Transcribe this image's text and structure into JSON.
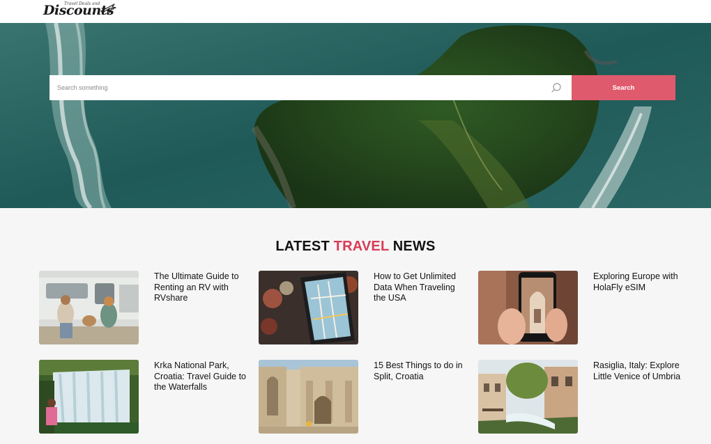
{
  "header": {
    "logo_text": "Discounts",
    "logo_small_text": "Travel Deals and"
  },
  "search": {
    "placeholder": "Search something",
    "button_label": "Search"
  },
  "news": {
    "title_prefix": "LATEST",
    "title_accent": "TRAVEL",
    "title_suffix": "NEWS",
    "accent_color": "#d93b55",
    "articles": [
      {
        "title": "The Ultimate Guide to Renting an RV with RVshare"
      },
      {
        "title": "How to Get Unlimited Data When Traveling the USA"
      },
      {
        "title": "Exploring Europe with HolaFly eSIM"
      },
      {
        "title": "Krka National Park, Croatia: Travel Guide to the Waterfalls"
      },
      {
        "title": "15 Best Things to do in Split, Croatia"
      },
      {
        "title": "Rasiglia, Italy: Explore Little Venice of Umbria"
      }
    ]
  },
  "colors": {
    "search_button": "#e05a6d",
    "page_background": "#f6f6f6"
  }
}
